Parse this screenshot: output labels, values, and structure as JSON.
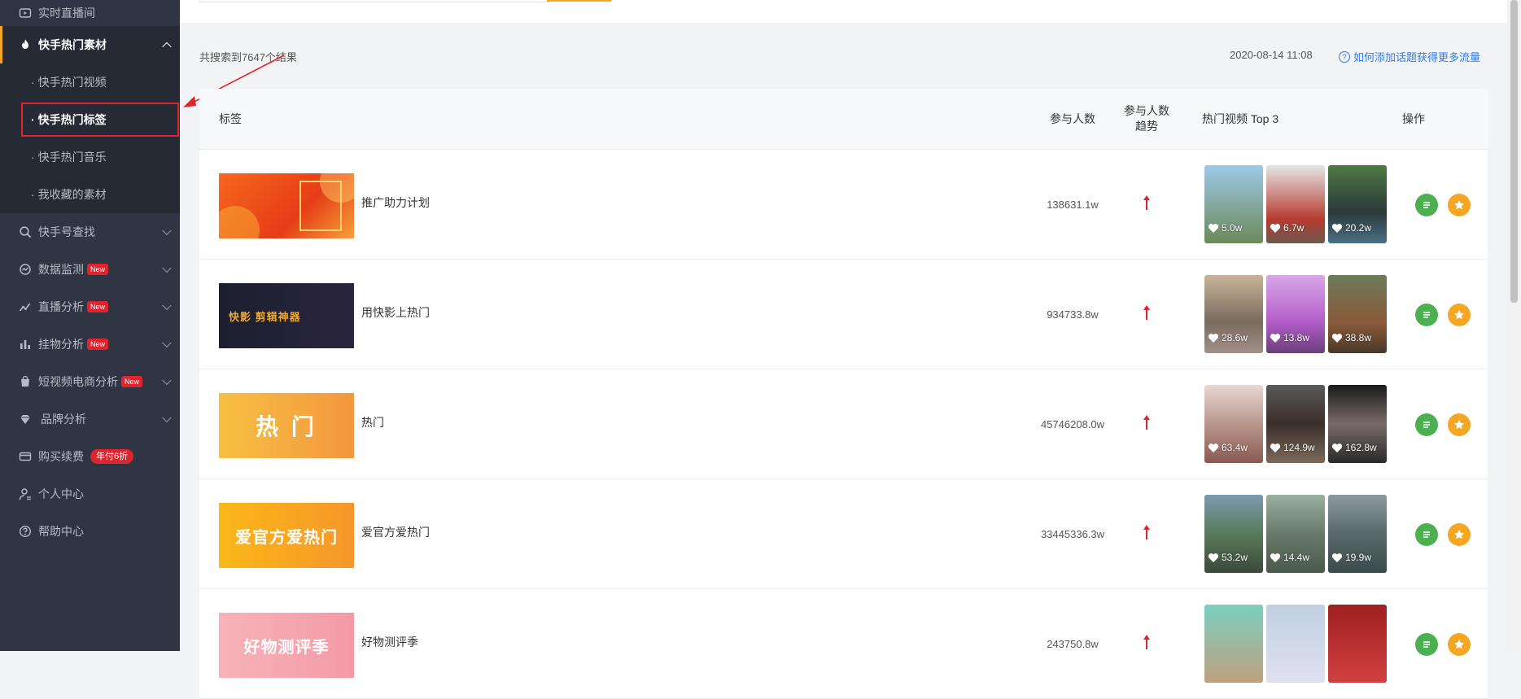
{
  "sidebar": {
    "items": [
      {
        "label": "实时直播间",
        "icon": "live-room-icon"
      },
      {
        "label": "快手热门素材",
        "icon": "fire-icon",
        "open": true
      },
      {
        "label": "快手号查找",
        "icon": "search-icon"
      },
      {
        "label": "数据监测",
        "icon": "monitor-icon",
        "badge": "New"
      },
      {
        "label": "直播分析",
        "icon": "trend-icon",
        "badge": "New"
      },
      {
        "label": "挂物分析",
        "icon": "bar-chart-icon",
        "badge": "New"
      },
      {
        "label": "短视频电商分析",
        "icon": "shopping-bag-icon",
        "badge": "New"
      },
      {
        "label": "品牌分析",
        "icon": "diamond-icon"
      },
      {
        "label": "购买续费",
        "icon": "card-icon",
        "pay_badge": "年付6折"
      },
      {
        "label": "个人中心",
        "icon": "user-icon"
      },
      {
        "label": "帮助中心",
        "icon": "help-icon"
      }
    ],
    "submenu": [
      "快手热门视频",
      "快手热门标签",
      "快手热门音乐",
      "我收藏的素材"
    ]
  },
  "meta": {
    "count_text": "共搜索到7647个结果",
    "date": "2020-08-14 11:08",
    "help_link": "如何添加话题获得更多流量"
  },
  "table": {
    "headers": {
      "tag": "标签",
      "users": "参与人数",
      "trend_line1": "参与人数",
      "trend_line2": "趋势",
      "top3": "热门视频 Top 3",
      "op": "操作"
    },
    "rows": [
      {
        "name": "推广助力计划",
        "users": "138631.1w",
        "thumb_text": "",
        "videos": [
          "5.0w",
          "6.7w",
          "20.2w"
        ]
      },
      {
        "name": "用快影上热门",
        "users": "934733.8w",
        "thumb_text": "快影 剪辑神器",
        "videos": [
          "28.6w",
          "13.8w",
          "38.8w"
        ]
      },
      {
        "name": "热门",
        "users": "45746208.0w",
        "thumb_text": "热 门",
        "videos": [
          "63.4w",
          "124.9w",
          "162.8w"
        ]
      },
      {
        "name": "爱官方爱热门",
        "users": "33445336.3w",
        "thumb_text": "爱官方爱热门",
        "videos": [
          "53.2w",
          "14.4w",
          "19.9w"
        ]
      },
      {
        "name": "好物测评季",
        "users": "243750.8w",
        "thumb_text": "好物测评季",
        "videos": [
          "",
          "",
          ""
        ]
      }
    ]
  },
  "colors": {
    "sidebar_bg": "#2f3542",
    "accent": "#f5a623",
    "link": "#2f7bea",
    "trend_up": "#e0242f",
    "op_list": "#4caf50",
    "op_star": "#f5a623"
  }
}
